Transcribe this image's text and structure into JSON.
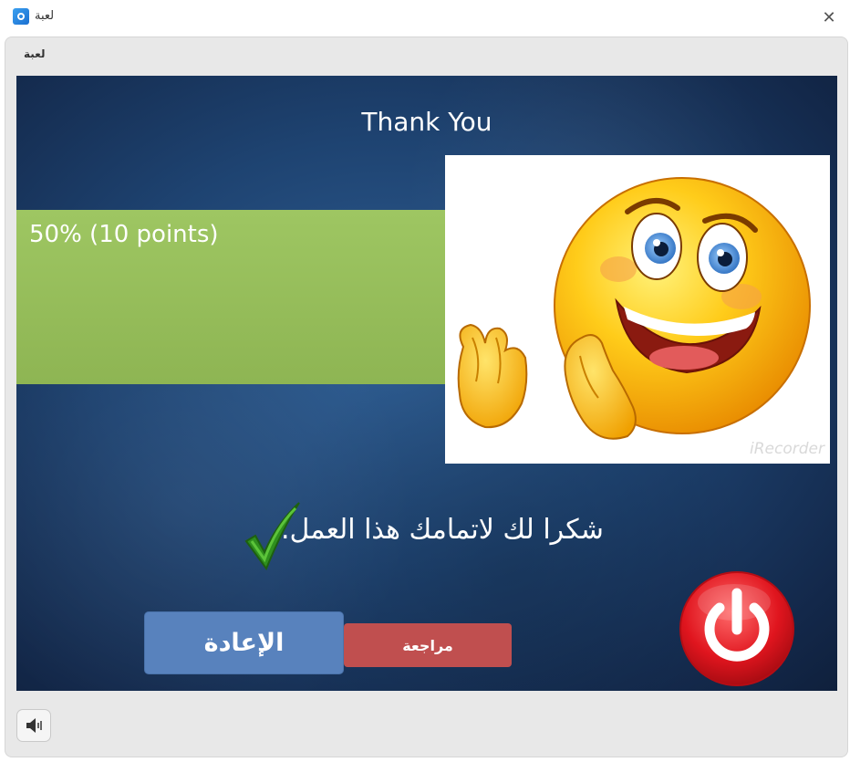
{
  "window": {
    "title": "لعبة",
    "app_icon": "app-icon",
    "close_icon": "close-icon"
  },
  "player": {
    "header_title": "لعبة"
  },
  "slide": {
    "title": "Thank You",
    "score_text": "50% (10 points)",
    "image_watermark": "iRecorder",
    "message": "شكرا لك لاتمامك هذا العمل.",
    "score_color": "#9bc35f",
    "retry_label": "الإعادة",
    "review_label": "مراجعة",
    "retry_color": "#5882bd",
    "review_color": "#c04f4f",
    "power_color": "#e0151e"
  },
  "controls": {
    "sound_icon": "speaker-icon"
  }
}
